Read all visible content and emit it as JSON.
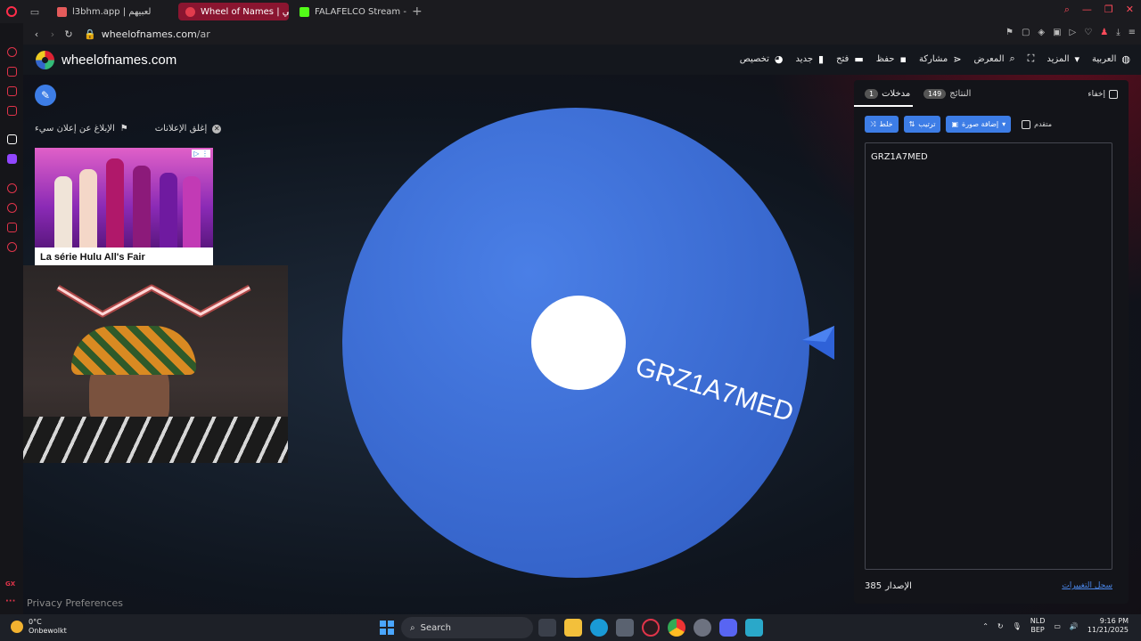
{
  "browser": {
    "tabs": [
      {
        "label": "l3bhm.app | لعبيهم",
        "active": false,
        "color": "#e45b5b"
      },
      {
        "label": "Wheel of Names | عشوائي",
        "active": true,
        "color": "#e23c4d"
      },
      {
        "label": "FALAFELCO Stream - Wat",
        "active": false,
        "color": "#53fc18"
      }
    ],
    "url_host": "wheelofnames.com",
    "url_path": "/ar"
  },
  "site": {
    "brand": "wheelofnames.com",
    "menu": [
      {
        "label": "تخصيص",
        "icon": "palette-icon"
      },
      {
        "label": "جديد",
        "icon": "file-icon"
      },
      {
        "label": "فتح",
        "icon": "folder-icon"
      },
      {
        "label": "حفظ",
        "icon": "save-icon"
      },
      {
        "label": "مشاركة",
        "icon": "share-icon"
      },
      {
        "label": "المعرض",
        "icon": "search-icon"
      },
      {
        "label": "",
        "icon": "fullscreen-icon"
      },
      {
        "label": "المزيد",
        "icon": "dropdown-icon"
      },
      {
        "label": "العربية",
        "icon": "globe-icon"
      }
    ],
    "report_ad": "الإبلاغ عن إعلان سيء",
    "close_ads": "إغلق الإعلانات",
    "ad_caption": "La série Hulu All's Fair",
    "privacy": "Privacy Preferences"
  },
  "wheel": {
    "entry": "GRZ1A7MED",
    "color": "#3a6fd8",
    "center_color": "#ffffff"
  },
  "panel": {
    "tab_entries": "مدخلات",
    "entries_count": "1",
    "tab_results": "النتائج",
    "results_count": "149",
    "hide_label": "إخفاء",
    "shuffle": "خلط",
    "sort": "ترتيب",
    "add_image": "إضافة صورة",
    "advanced": "متقدم",
    "entries": [
      "GRZ1A7MED"
    ],
    "version_label": "الإصدار",
    "version": "385",
    "changelog": "سجل التغييرات"
  },
  "taskbar": {
    "temp": "0°C",
    "weather": "Onbewolkt",
    "search": "Search",
    "lang_top": "NLD",
    "lang_bottom": "BEP",
    "time": "9:16 PM",
    "date": "11/21/2025"
  }
}
